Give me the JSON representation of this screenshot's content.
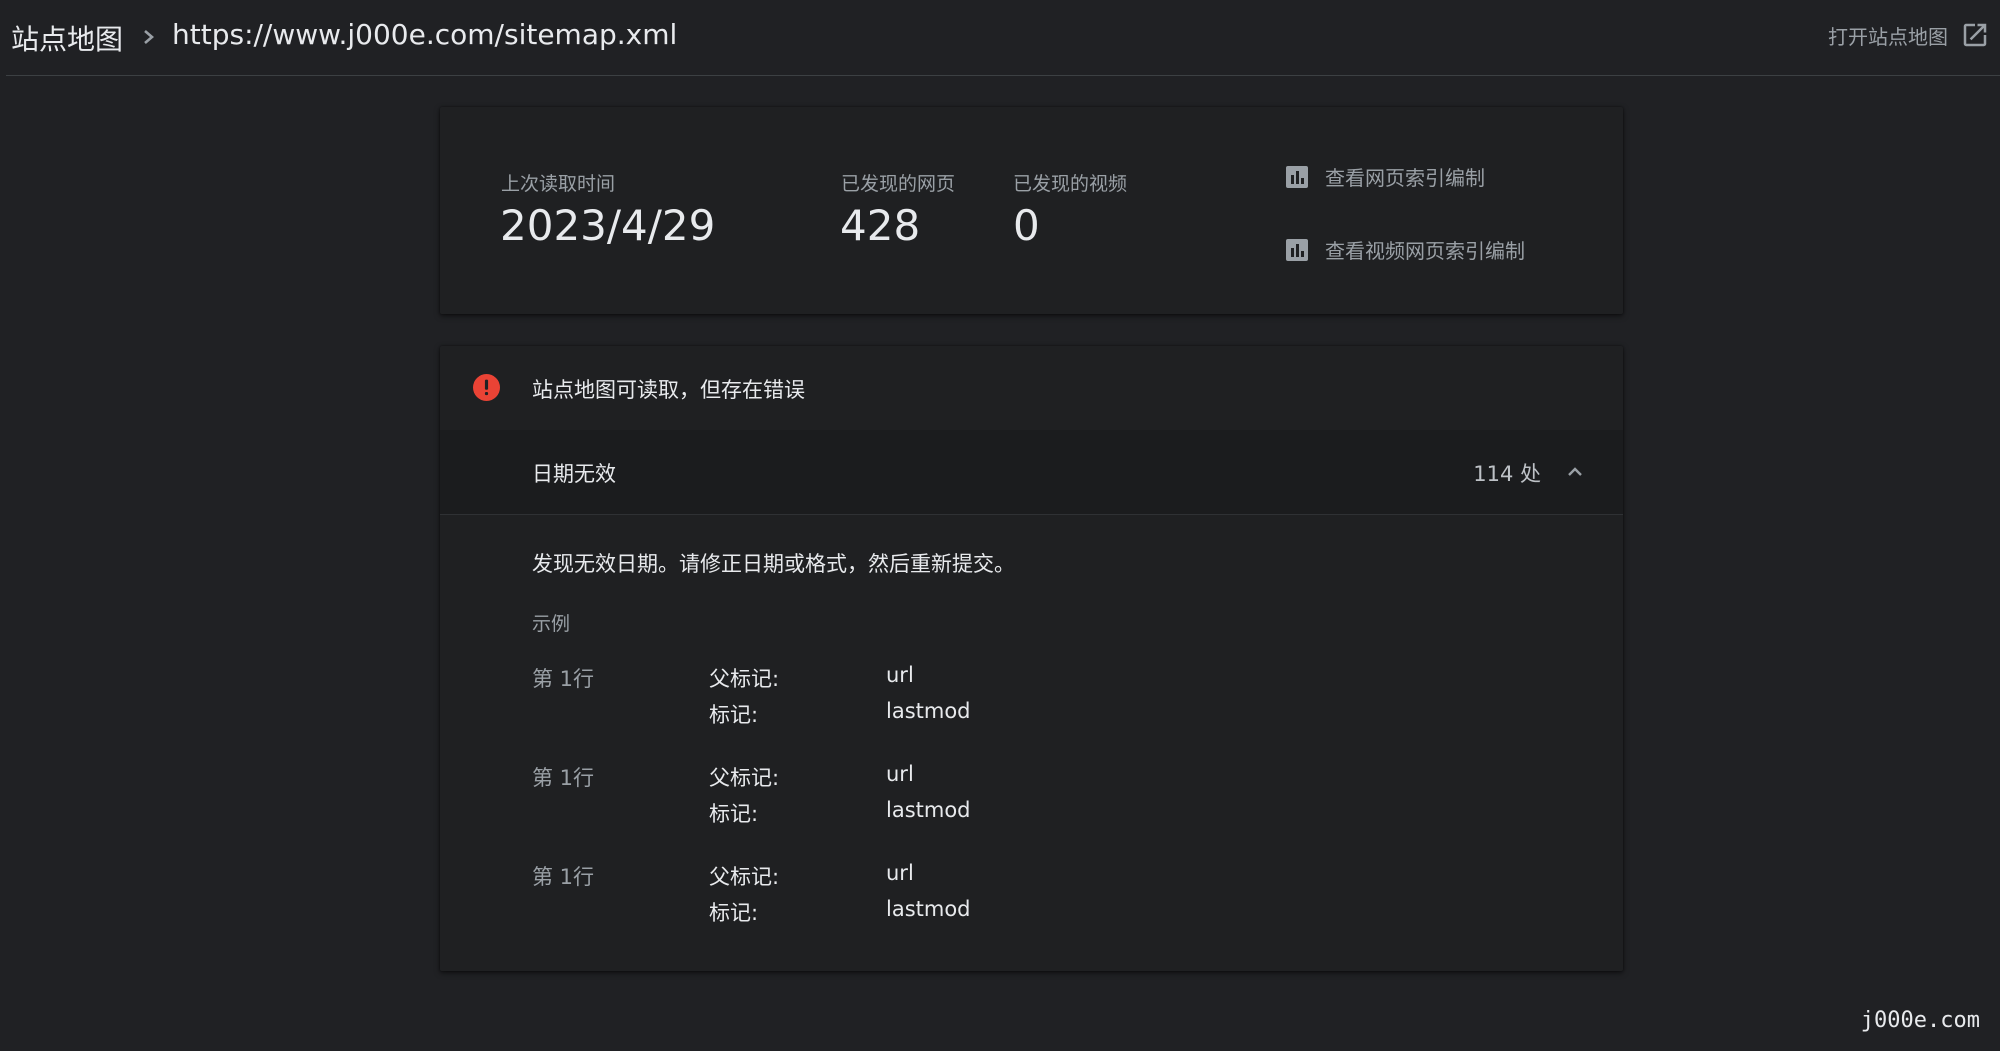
{
  "breadcrumb": {
    "root": "站点地图",
    "current": "https://www.j000e.com/sitemap.xml"
  },
  "header": {
    "open_link_label": "打开站点地图",
    "open_link_icon": "open-in-new-icon"
  },
  "stats": {
    "last_read": {
      "label": "上次读取时间",
      "value": "2023/4/29"
    },
    "pages": {
      "label": "已发现的网页",
      "value": "428"
    },
    "videos": {
      "label": "已发现的视频",
      "value": "0"
    }
  },
  "report_links": [
    {
      "label": "查看网页索引编制",
      "icon": "bar-chart-icon"
    },
    {
      "label": "查看视频网页索引编制",
      "icon": "bar-chart-icon"
    }
  ],
  "status": {
    "icon": "error-icon",
    "title": "站点地图可读取，但存在错误",
    "color": "#ea4335"
  },
  "issue": {
    "name": "日期无效",
    "count": "114 处",
    "description": "发现无效日期。请修正日期或格式，然后重新提交。",
    "examples_label": "示例",
    "examples": [
      {
        "line": "第 1行",
        "parent_label": "父标记:",
        "parent_value": "url",
        "tag_label": "标记:",
        "tag_value": "lastmod"
      },
      {
        "line": "第 1行",
        "parent_label": "父标记:",
        "parent_value": "url",
        "tag_label": "标记:",
        "tag_value": "lastmod"
      },
      {
        "line": "第 1行",
        "parent_label": "父标记:",
        "parent_value": "url",
        "tag_label": "标记:",
        "tag_value": "lastmod"
      }
    ]
  },
  "watermark": "j000e.com"
}
